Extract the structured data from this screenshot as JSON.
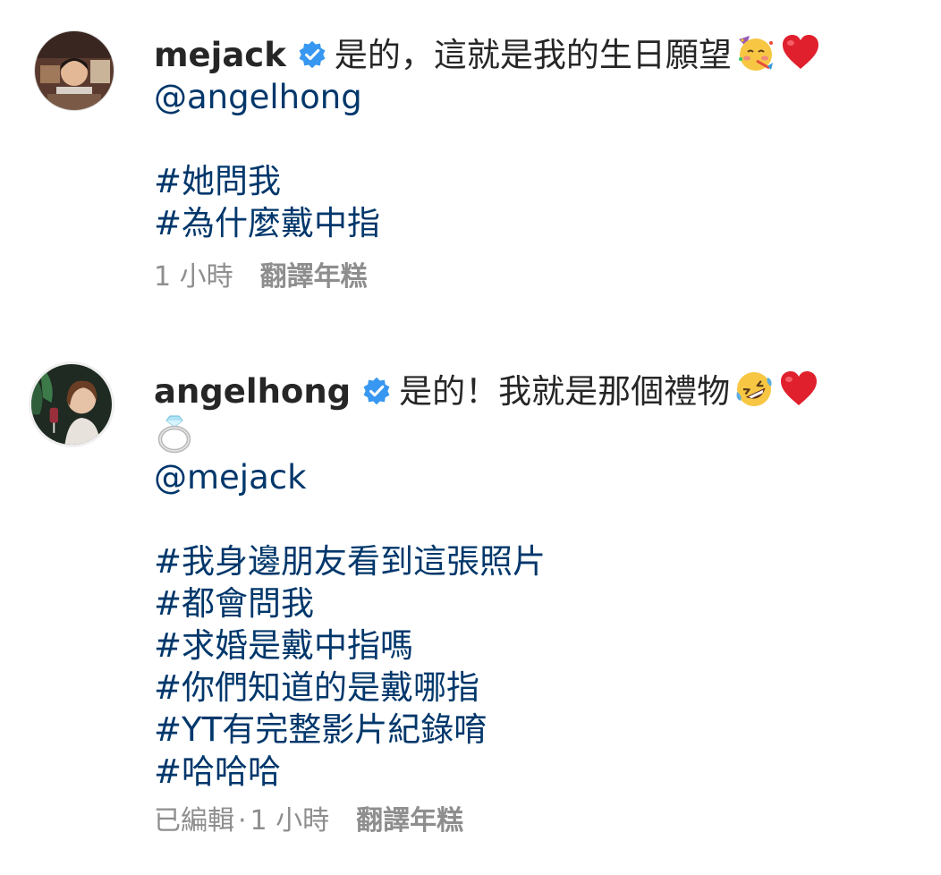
{
  "comments": [
    {
      "username": "mejack",
      "avatar": "profile-photo",
      "text": "是的，這就是我的生日願望",
      "emojis": [
        "partying-face-emoji",
        "red-heart-emoji"
      ],
      "mention": "@angelhong",
      "hashtags": [
        "#她問我",
        "#為什麼戴中指"
      ],
      "time": "1 小時",
      "translate": "翻譯年糕"
    },
    {
      "username": "angelhong",
      "avatar": "profile-photo",
      "text": "是的！我就是那個禮物",
      "emojis": [
        "rolling-laughing-emoji",
        "red-heart-emoji",
        "ring-emoji"
      ],
      "mention": "@mejack",
      "hashtags": [
        "#我身邊朋友看到這張照片",
        "#都會問我",
        "#求婚是戴中指嗎",
        "#你們知道的是戴哪指",
        "#YT有完整影片紀錄唷",
        "#哈哈哈"
      ],
      "edited": "已編輯",
      "separator": "·",
      "time": "1 小時",
      "translate": "翻譯年糕"
    }
  ],
  "colors": {
    "text": "#262626",
    "link": "#00376b",
    "meta": "#8e8e8e",
    "verified": "#3897f0"
  }
}
